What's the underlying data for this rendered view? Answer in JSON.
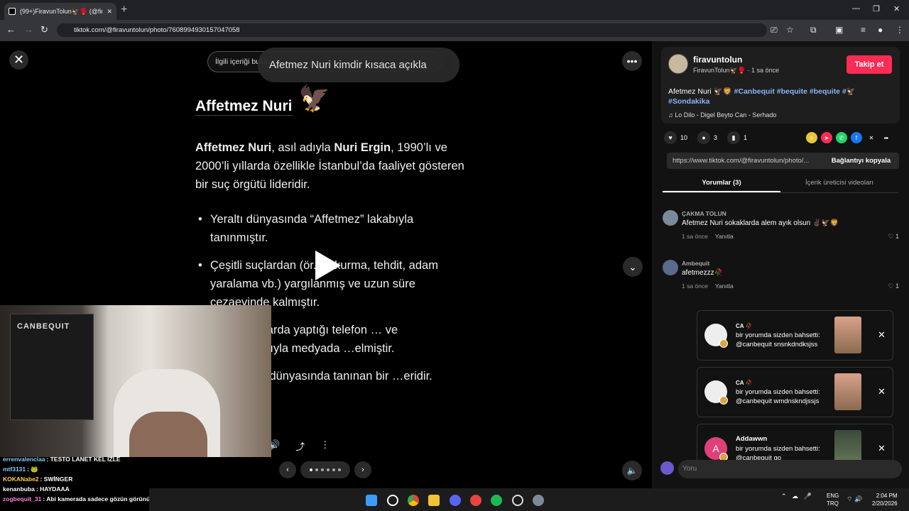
{
  "browser": {
    "tab_title": "(99+)FiravunTolun🦅🥊 (@fira",
    "url": "tiktok.com/@firavuntolun/photo/7608994930157047058"
  },
  "viewer": {
    "search_placeholder": "İlgili içeriği bulun",
    "search_tooltip": "Afetmez Nuri kimdir kısaca açıkla",
    "photo": {
      "heading": "Affetmez Nuri",
      "intro_parts": [
        "Affetmez Nuri",
        ", asıl adıyla ",
        "Nuri Ergin",
        ", 1990’lı ve 2000’li yıllarda özellikle İstanbul’da faaliyet gösteren bir suç örgütü lideridir."
      ],
      "bullets": [
        "Yeraltı dünyasında “Affetmez” lakabıyla tanınmıştır.",
        "Çeşitli suçlardan (ör. … kurma, tehdit, adam yaralama vb.) yargılanmış ve uzun süre cezaevinde kalmıştır.",
        "…000’li yıllarda yaptığı telefon … ve açıklamalarıyla medyada …elmiştir.",
        "…ul yeraltı dünyasında tanınan bir …eridir."
      ]
    }
  },
  "webcam": {
    "poster_title": "CANBEQUIT"
  },
  "chat": [
    {
      "user": "errenvalenciaa",
      "text": ": TESTO LANET KEL İZLE",
      "color": "#7fd1ff"
    },
    {
      "user": "mtf3131",
      "text": ": 🐸",
      "color": "#7fd1ff"
    },
    {
      "user": "KOKANabe2",
      "text": ": SWİNGER",
      "color": "#ffd23f"
    },
    {
      "user": "kenanbuba",
      "text": ": HAYDAAA",
      "color": "#ffffff"
    },
    {
      "user": "zogbequit_31",
      "text": ": Abi kamerada sadece gözün görünüyor",
      "color": "#ff7fe0"
    }
  ],
  "panel": {
    "username": "firavuntolun",
    "display_name": "FiravunTolun🦅🥊",
    "time": "1 sa önce",
    "follow_label": "Takip et",
    "caption_text": "Afetmez Nuri 🦅🦁 ",
    "caption_tags": "#Canbequit #bequite #bequite #🦅 #Sondakika",
    "music": "Lo Dilo - Digel Beyto Can - Serhado",
    "likes": "10",
    "comments": "3",
    "saves": "1",
    "link": "https://www.tiktok.com/@firavuntolun/photo/...",
    "copy_link": "Bağlantıyı kopyala",
    "tab_comments": "Yorumlar (3)",
    "tab_creator": "İçerik üreticisi videoları",
    "comment_list": [
      {
        "name": "ÇAKMA TOLUN",
        "text": "Afetmez Nuri sokaklarda alem ayık olsun ✌🏿🦅🦁",
        "time": "1 sa önce",
        "reply": "Yanıtla",
        "likes": "1"
      },
      {
        "name": "Ambequit",
        "text": "afetmezzz🥀",
        "time": "1 sa önce",
        "reply": "Yanıtla",
        "likes": "1"
      }
    ],
    "comment_placeholder": "Yoru"
  },
  "notifications": [
    {
      "title": "CA 🥀",
      "line1": "bir yorumda sizden bahsetti:",
      "line2": "@canbequit snsnkdndksjss"
    },
    {
      "title": "CA 🥀",
      "line1": "bir yorumda sizden bahsetti:",
      "line2": "@canbequit wmdnskndjssjs"
    },
    {
      "title": "Addawwn",
      "line1": "bir yorumda sizden bahsetti:",
      "line2": "@canbequit go",
      "initial": "A"
    }
  ],
  "taskbar": {
    "lang1": "ENG",
    "lang2": "TRQ",
    "time": "2:04 PM",
    "date": "2/20/2026"
  },
  "colors": {
    "accent": "#fe2c55",
    "tag": "#8ab4f8"
  }
}
